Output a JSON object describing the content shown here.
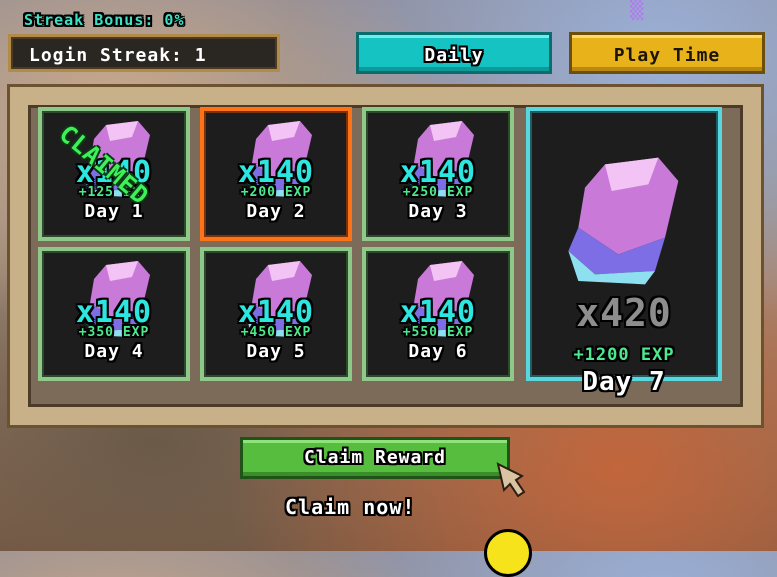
{
  "header": {
    "streak_bonus": "Streak Bonus: 0%",
    "login_streak": "Login Streak: 1"
  },
  "tabs": {
    "daily": "Daily",
    "play_time": "Play Time"
  },
  "rewards": [
    {
      "day": "Day 1",
      "amount": "x140",
      "exp": "+125 EXP",
      "claimed": true,
      "stamp": "CLAIMED"
    },
    {
      "day": "Day 2",
      "amount": "x140",
      "exp": "+200 EXP",
      "current": true
    },
    {
      "day": "Day 3",
      "amount": "x140",
      "exp": "+250 EXP"
    },
    {
      "day": "Day 4",
      "amount": "x140",
      "exp": "+350 EXP"
    },
    {
      "day": "Day 5",
      "amount": "x140",
      "exp": "+450 EXP"
    },
    {
      "day": "Day 6",
      "amount": "x140",
      "exp": "+550 EXP"
    },
    {
      "day": "Day 7",
      "amount": "x420",
      "exp": "+1200 EXP"
    }
  ],
  "footer": {
    "claim_button": "Claim Reward",
    "claim_hint": "Claim now!"
  },
  "colors": {
    "accent_teal": "#16c3c3",
    "accent_gold": "#e7b21a",
    "claim_green": "#56bd3f",
    "current_orange": "#ff7318"
  },
  "icons": {
    "reward_item": "crystal-gem-icon",
    "cursor": "pointer-cursor-icon"
  }
}
